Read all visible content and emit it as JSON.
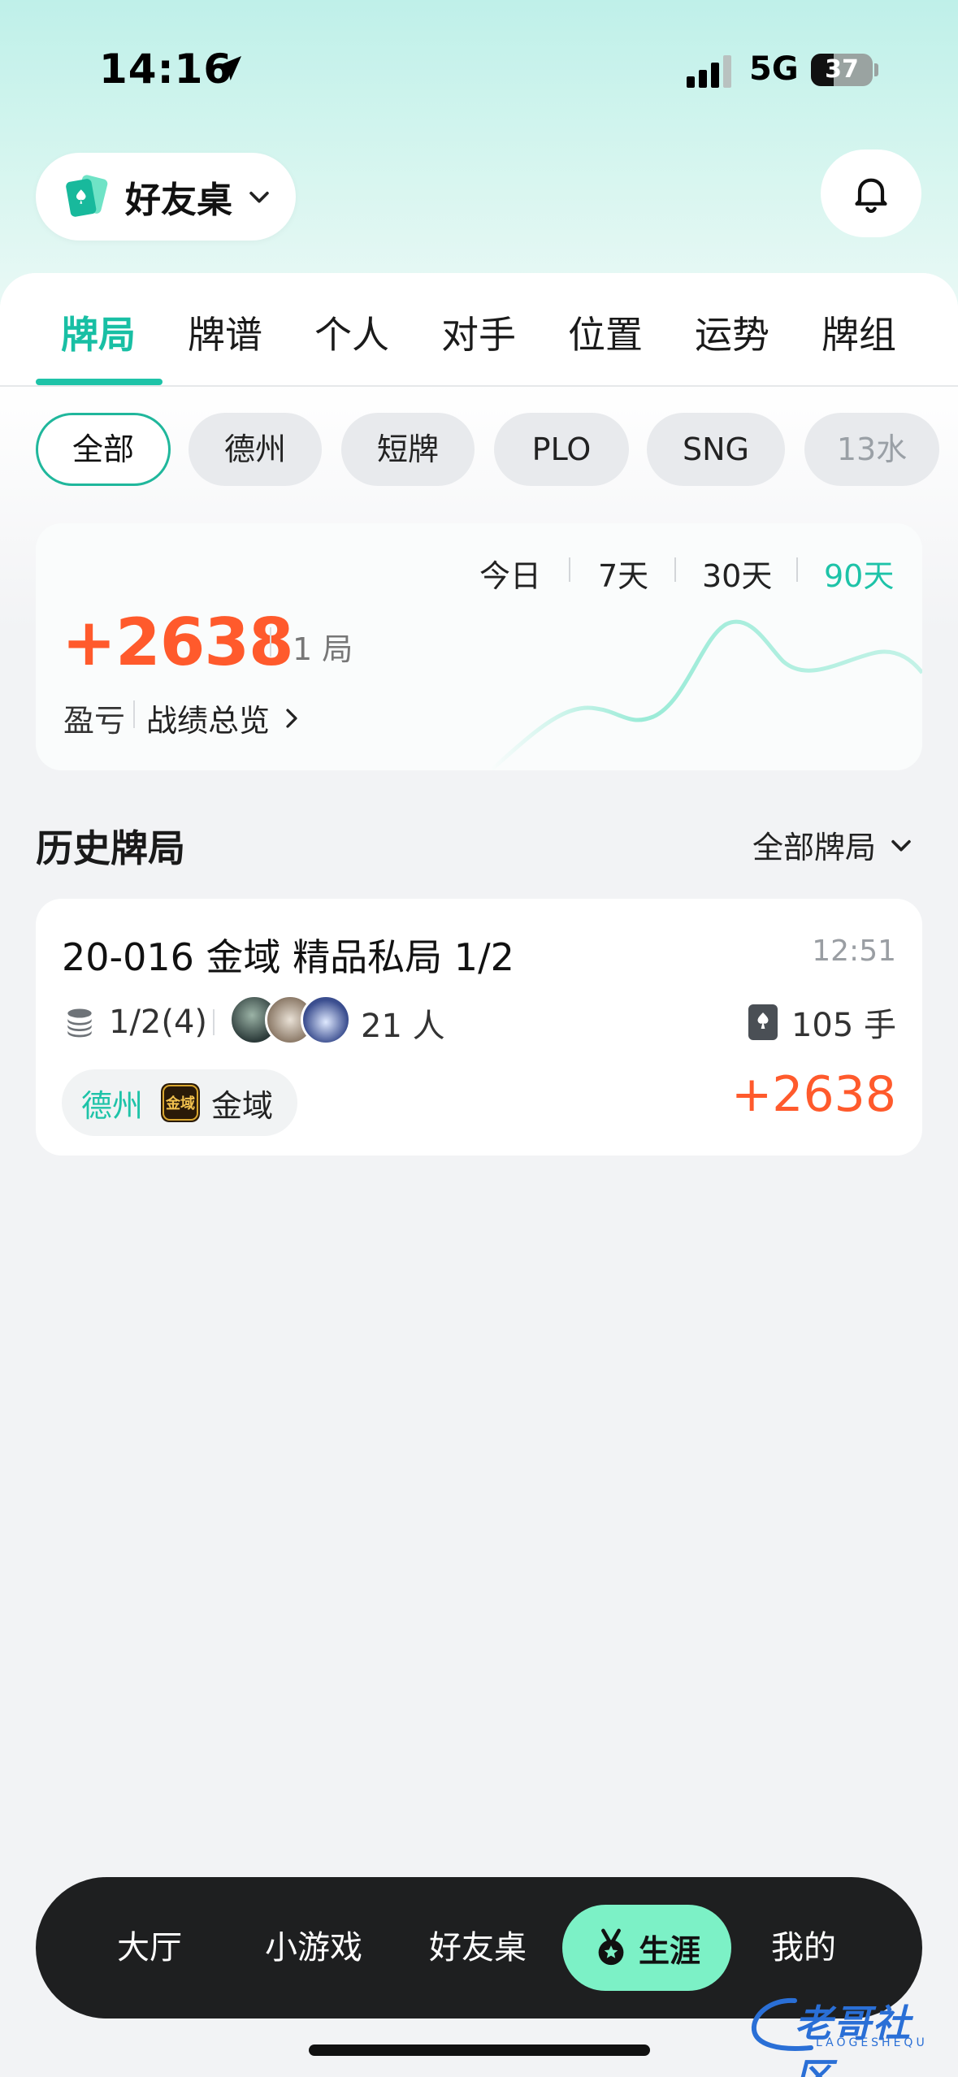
{
  "status_bar": {
    "time": "14:16",
    "network": "5G",
    "battery": "37"
  },
  "header": {
    "club_name": "好友桌"
  },
  "tabs": [
    {
      "label": "牌局",
      "active": true
    },
    {
      "label": "牌谱"
    },
    {
      "label": "个人"
    },
    {
      "label": "对手"
    },
    {
      "label": "位置"
    },
    {
      "label": "运势"
    },
    {
      "label": "牌组"
    }
  ],
  "filters": [
    {
      "label": "全部",
      "active": true
    },
    {
      "label": "德州"
    },
    {
      "label": "短牌"
    },
    {
      "label": "PLO"
    },
    {
      "label": "SNG"
    },
    {
      "label": "13水"
    }
  ],
  "stats": {
    "ranges": [
      "今日",
      "7天",
      "30天",
      "90天"
    ],
    "active_range": "90天",
    "profit": "+2638",
    "games": "1 局",
    "profit_label": "盈亏",
    "overview_link": "战绩总览"
  },
  "history": {
    "title": "历史牌局",
    "filter_label": "全部牌局",
    "games": [
      {
        "title": "20-016 金域 精品私局 1/2",
        "time": "12:51",
        "blinds": "1/2(4)",
        "players": "21 人",
        "hands": "105 手",
        "game_type": "德州",
        "club": "金域",
        "club_logo_text": "金域",
        "profit": "+2638"
      }
    ]
  },
  "bottom_nav": {
    "items": [
      "大厅",
      "小游戏",
      "好友桌",
      "生涯",
      "我的"
    ],
    "active": "生涯"
  },
  "watermark": {
    "text": "老哥社区",
    "sub": "LAOGESHEQU"
  },
  "colors": {
    "accent": "#1ec3a8",
    "profit": "#ff5a2c",
    "nav_active": "#7cf1c6"
  }
}
